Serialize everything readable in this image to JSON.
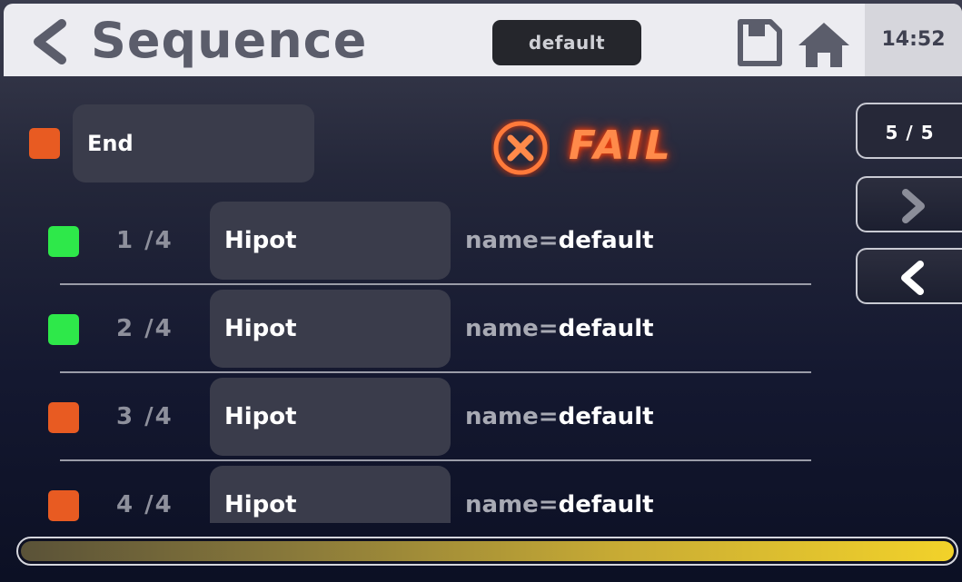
{
  "header": {
    "back_icon": "chevron-left-icon",
    "title": "Sequence",
    "mode_label": "default",
    "save_icon": "floppy-disk-icon",
    "home_icon": "home-icon",
    "clock": "14:52"
  },
  "sequence": {
    "end_label": "End",
    "end_status_color": "#e85b22",
    "result": {
      "icon": "x-circle-icon",
      "label": "FAIL",
      "color": "#ff6a2a"
    }
  },
  "pager": {
    "page_label": "5 / 5",
    "next_icon": "chevron-right-icon",
    "prev_icon": "chevron-left-icon"
  },
  "steps": [
    {
      "index": "1 /4",
      "test": "Hipot",
      "param_key": "name=",
      "param_value": "default",
      "status": "pass",
      "status_color": "#2ee84a"
    },
    {
      "index": "2 /4",
      "test": "Hipot",
      "param_key": "name=",
      "param_value": "default",
      "status": "pass",
      "status_color": "#2ee84a"
    },
    {
      "index": "3 /4",
      "test": "Hipot",
      "param_key": "name=",
      "param_value": "default",
      "status": "fail",
      "status_color": "#e85b22"
    },
    {
      "index": "4 /4",
      "test": "Hipot",
      "param_key": "name=",
      "param_value": "default",
      "status": "fail",
      "status_color": "#e85b22"
    }
  ],
  "progress": {
    "fraction": 1.0
  }
}
